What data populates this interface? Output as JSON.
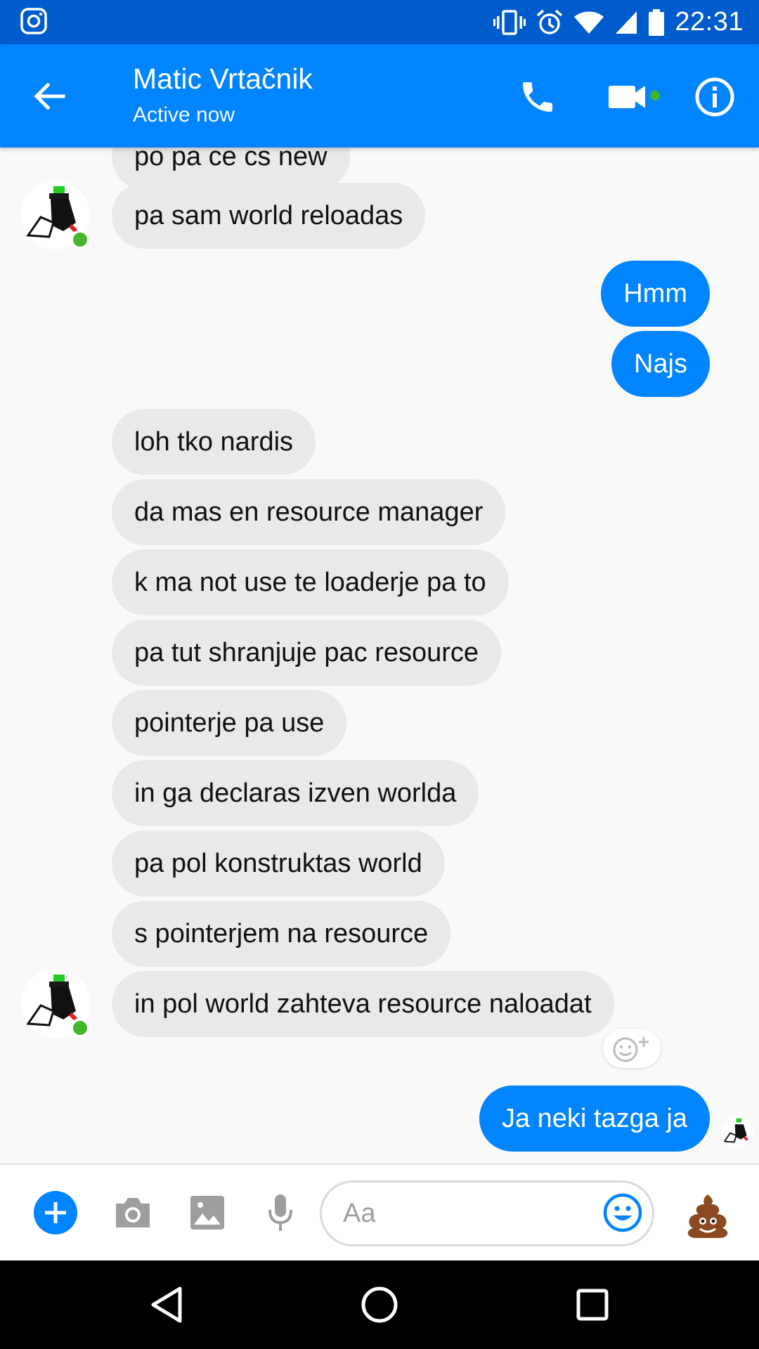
{
  "status_bar": {
    "time": "22:31",
    "icons": [
      "instagram-icon",
      "vibrate-icon",
      "alarm-icon",
      "wifi-icon",
      "signal-icon",
      "battery-icon"
    ]
  },
  "header": {
    "contact_name": "Matic Vrtačnik",
    "contact_status": "Active now",
    "icons": [
      "back-arrow-icon",
      "phone-icon",
      "video-camera-icon",
      "info-icon"
    ],
    "active_dot_color": "#42b72a"
  },
  "messages": [
    {
      "from": "them",
      "text": "po pa ce cs new"
    },
    {
      "from": "them",
      "text": "pa sam world reloadas"
    },
    {
      "from": "me",
      "text": "Hmm"
    },
    {
      "from": "me",
      "text": "Najs"
    },
    {
      "from": "them",
      "text": "loh tko nardis"
    },
    {
      "from": "them",
      "text": "da mas en resource manager"
    },
    {
      "from": "them",
      "text": "k ma not use te loaderje pa to"
    },
    {
      "from": "them",
      "text": "pa tut shranjuje pac resource"
    },
    {
      "from": "them",
      "text": "pointerje pa use"
    },
    {
      "from": "them",
      "text": "in ga declaras izven worlda"
    },
    {
      "from": "them",
      "text": "pa pol konstruktas world"
    },
    {
      "from": "them",
      "text": "s pointerjem na resource"
    },
    {
      "from": "them",
      "text": "in pol world zahteva resource naloadat"
    },
    {
      "from": "me",
      "text": "Ja neki tazga ja"
    }
  ],
  "composer": {
    "placeholder": "Aa",
    "icons": [
      "plus-icon",
      "camera-icon",
      "image-icon",
      "microphone-icon",
      "emoji-icon",
      "poop-emoji-icon"
    ]
  },
  "nav_bar": {
    "icons": [
      "nav-back-icon",
      "nav-home-icon",
      "nav-recents-icon"
    ]
  },
  "colors": {
    "brand_blue": "#0084ff",
    "status_bar_blue": "#005ccd",
    "incoming_bubble": "#e9e9e9",
    "outgoing_bubble": "#0084ff",
    "online_green": "#42b72a"
  }
}
